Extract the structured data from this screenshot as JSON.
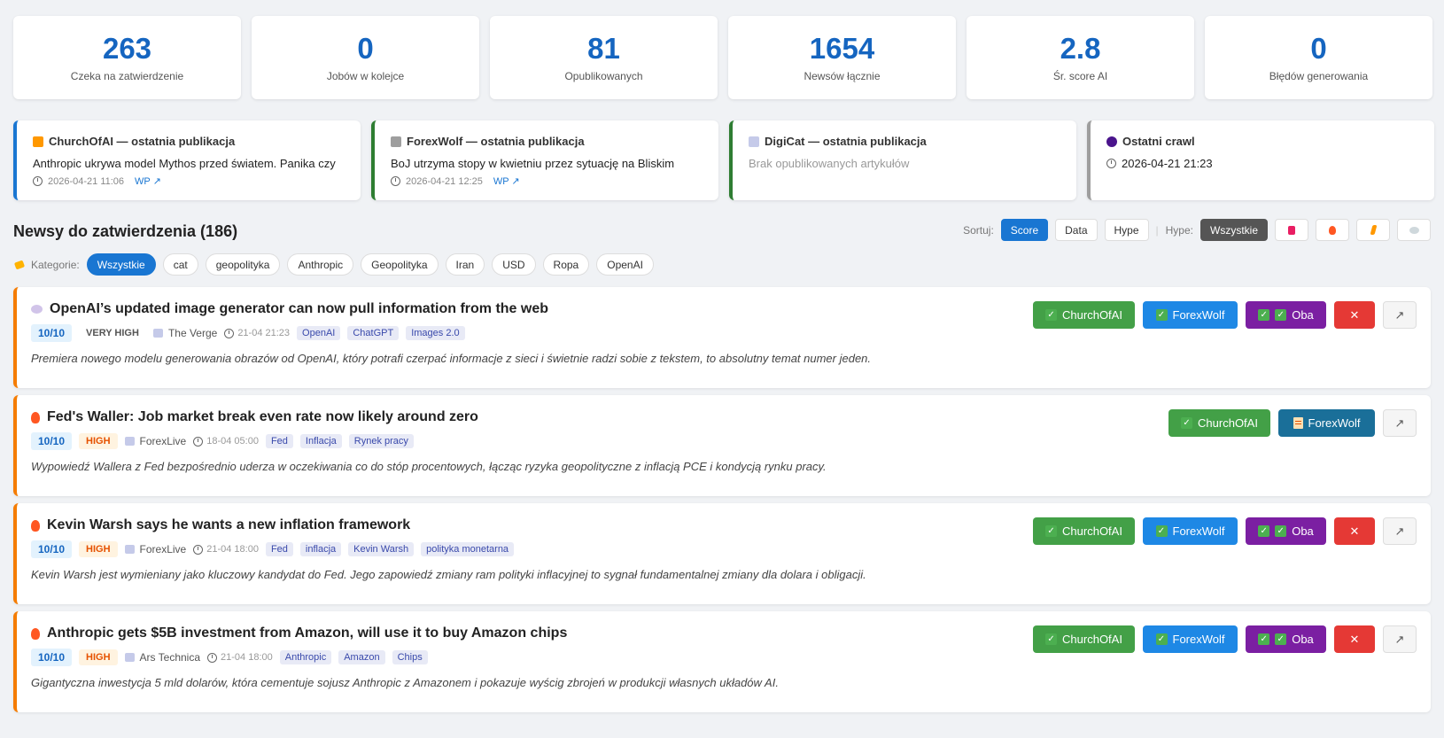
{
  "stats": [
    {
      "value": "263",
      "label": "Czeka na zatwierdzenie"
    },
    {
      "value": "0",
      "label": "Jobów w kolejce"
    },
    {
      "value": "81",
      "label": "Opublikowanych"
    },
    {
      "value": "1654",
      "label": "Newsów łącznie"
    },
    {
      "value": "2.8",
      "label": "Śr. score AI"
    },
    {
      "value": "0",
      "label": "Błędów generowania"
    }
  ],
  "publications": [
    {
      "title": "ChurchOfAI — ostatnia publikacja",
      "text": "Anthropic ukrywa model Mythos przed światem. Panika czy",
      "date": "2026-04-21 11:06",
      "link": "WP ↗"
    },
    {
      "title": "ForexWolf — ostatnia publikacja",
      "text": "BoJ utrzyma stopy w kwietniu przez sytuację na Bliskim",
      "date": "2026-04-21 12:25",
      "link": "WP ↗"
    },
    {
      "title": "DigiCat — ostatnia publikacja",
      "text": "Brak opublikowanych artykułów"
    },
    {
      "title": "Ostatni crawl",
      "date": "2026-04-21 21:23"
    }
  ],
  "section_title": "Newsy do zatwierdzenia (186)",
  "sort": {
    "label": "Sortuj:",
    "options": [
      "Score",
      "Data",
      "Hype"
    ],
    "hype_label": "Hype:",
    "hype_all": "Wszystkie"
  },
  "categories": {
    "label": "Kategorie:",
    "items": [
      "Wszystkie",
      "cat",
      "geopolityka",
      "Anthropic",
      "Geopolityka",
      "Iran",
      "USD",
      "Ropa",
      "OpenAI"
    ]
  },
  "actions": {
    "church": "ChurchOfAI",
    "forex": "ForexWolf",
    "both": "Oba",
    "reject": "✕",
    "open": "↗"
  },
  "news": [
    {
      "title": "OpenAI’s updated image generator can now pull information from the web",
      "score": "10/10",
      "hype": "VERY HIGH",
      "source": "The Verge",
      "date": "21-04 21:23",
      "tags": [
        "OpenAI",
        "ChatGPT",
        "Images 2.0"
      ],
      "desc": "Premiera nowego modelu generowania obrazów od OpenAI, który potrafi czerpać informacje z sieci i świetnie radzi sobie z tekstem, to absolutny temat numer jeden."
    },
    {
      "title": "Fed's Waller: Job market break even rate now likely around zero",
      "score": "10/10",
      "hype": "HIGH",
      "source": "ForexLive",
      "date": "18-04 05:00",
      "tags": [
        "Fed",
        "Inflacja",
        "Rynek pracy"
      ],
      "desc": "Wypowiedź Wallera z Fed bezpośrednio uderza w oczekiwania co do stóp procentowych, łącząc ryzyka geopolityczne z inflacją PCE i kondycją rynku pracy."
    },
    {
      "title": "Kevin Warsh says he wants a new inflation framework",
      "score": "10/10",
      "hype": "HIGH",
      "source": "ForexLive",
      "date": "21-04 18:00",
      "tags": [
        "Fed",
        "inflacja",
        "Kevin Warsh",
        "polityka monetarna"
      ],
      "desc": "Kevin Warsh jest wymieniany jako kluczowy kandydat do Fed. Jego zapowiedź zmiany ram polityki inflacyjnej to sygnał fundamentalnej zmiany dla dolara i obligacji."
    },
    {
      "title": "Anthropic gets $5B investment from Amazon, will use it to buy Amazon chips",
      "score": "10/10",
      "hype": "HIGH",
      "source": "Ars Technica",
      "date": "21-04 18:00",
      "tags": [
        "Anthropic",
        "Amazon",
        "Chips"
      ],
      "desc": "Gigantyczna inwestycja 5 mld dolarów, która cementuje sojusz Anthropic z Amazonem i pokazuje wyścig zbrojeń w produkcji własnych układów AI."
    }
  ]
}
